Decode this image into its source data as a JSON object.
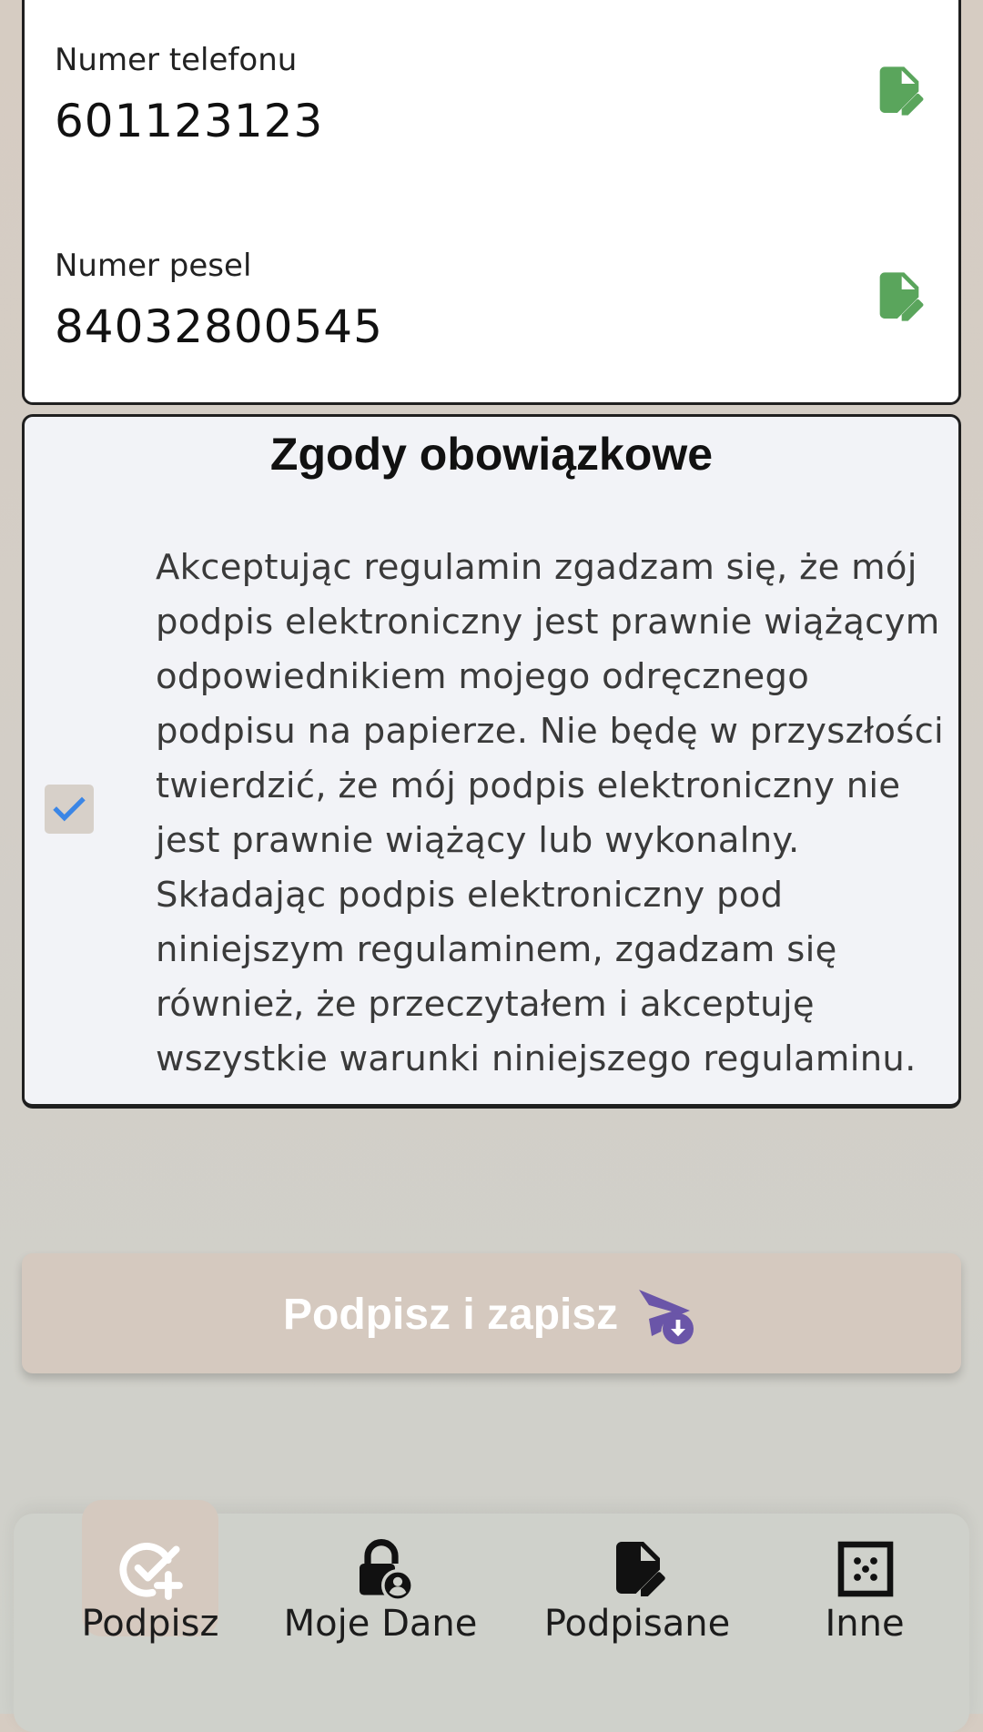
{
  "fields": {
    "phone": {
      "label": "Numer telefonu",
      "value": "601123123",
      "icon": "file-edit-icon"
    },
    "pesel": {
      "label": "Numer pesel",
      "value": "84032800545",
      "icon": "file-edit-icon"
    }
  },
  "consents": {
    "title": "Zgody obowiązkowe",
    "checked": true,
    "text": "Akceptując regulamin zgadzam się, że mój podpis elektroniczny jest prawnie wiążącym odpowiednikiem mojego odręcznego podpisu na papierze. Nie będę w przyszłości twierdzić, że mój podpis elektroniczny nie jest prawnie wiążący lub wykonalny. Składając podpis elektroniczny pod niniejszym regulaminem, zgadzam się również, że przeczytałem i akceptuję wszystkie warunki niniejszego regulaminu."
  },
  "sign_button": {
    "label": "Podpisz i zapisz",
    "icon": "send-download-icon"
  },
  "nav": {
    "items": [
      {
        "label": "Podpisz",
        "icon": "check-circle-plus-icon",
        "active": true
      },
      {
        "label": "Moje Dane",
        "icon": "lock-user-icon",
        "active": false
      },
      {
        "label": "Podpisane",
        "icon": "file-edit-icon",
        "active": false
      },
      {
        "label": "Inne",
        "icon": "dotted-grid-icon",
        "active": false
      }
    ]
  },
  "colors": {
    "edit_icon": "#5aa55c",
    "checkmark": "#3b86e6",
    "send_icon": "#6a55a8",
    "button_bg": "#d5c9bf",
    "active_nav_bg": "#d5c9bf"
  }
}
